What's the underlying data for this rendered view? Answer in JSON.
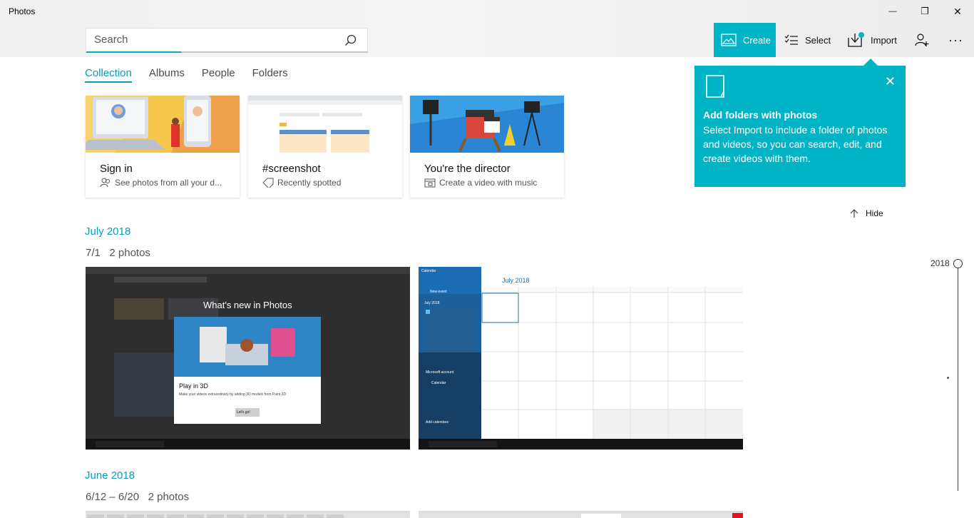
{
  "app": {
    "title": "Photos"
  },
  "window": {
    "minimize_glyph": "—",
    "restore_glyph": "❐",
    "close_glyph": "✕"
  },
  "search": {
    "placeholder": "Search",
    "value": ""
  },
  "toolbar": {
    "create_label": "Create",
    "select_label": "Select",
    "import_label": "Import",
    "more_glyph": "···"
  },
  "tabs": [
    {
      "label": "Collection",
      "active": true
    },
    {
      "label": "Albums",
      "active": false
    },
    {
      "label": "People",
      "active": false
    },
    {
      "label": "Folders",
      "active": false
    }
  ],
  "cards": [
    {
      "title": "Sign in",
      "subtitle": "See photos from all your d...",
      "icon": "people-icon"
    },
    {
      "title": "#screenshot",
      "subtitle": "Recently spotted",
      "icon": "tag-icon"
    },
    {
      "title": "You're the director",
      "subtitle": "Create a video with music",
      "icon": "film-icon"
    }
  ],
  "tip": {
    "title": "Add folders with photos",
    "body": "Select Import to include a folder of photos and videos, so you can search, edit, and create videos with them.",
    "close_glyph": "✕"
  },
  "hide_label": "Hide",
  "groups": [
    {
      "month": "July 2018",
      "date_range": "7/1",
      "count": "2 photos",
      "thumbs": [
        {
          "dialog_title": "What's new in Photos",
          "dialog_heading": "Play in 3D",
          "dialog_text": "Make your videos extraordinary by adding 3D models from Paint 3D",
          "dialog_button": "Let's go!"
        },
        {
          "app": "Calendar",
          "new_event": "New event",
          "month": "July 2018",
          "mini_month": "July 2018",
          "account": "Microsoft account",
          "calendar": "Calendar",
          "add_calendars": "Add calendars"
        }
      ]
    },
    {
      "month": "June 2018",
      "date_range": "6/12 – 6/20",
      "count": "2 photos"
    }
  ],
  "timeline": {
    "year": "2018"
  },
  "colors": {
    "accent": "#00b4c6",
    "accent_text": "#0a9cbb"
  }
}
